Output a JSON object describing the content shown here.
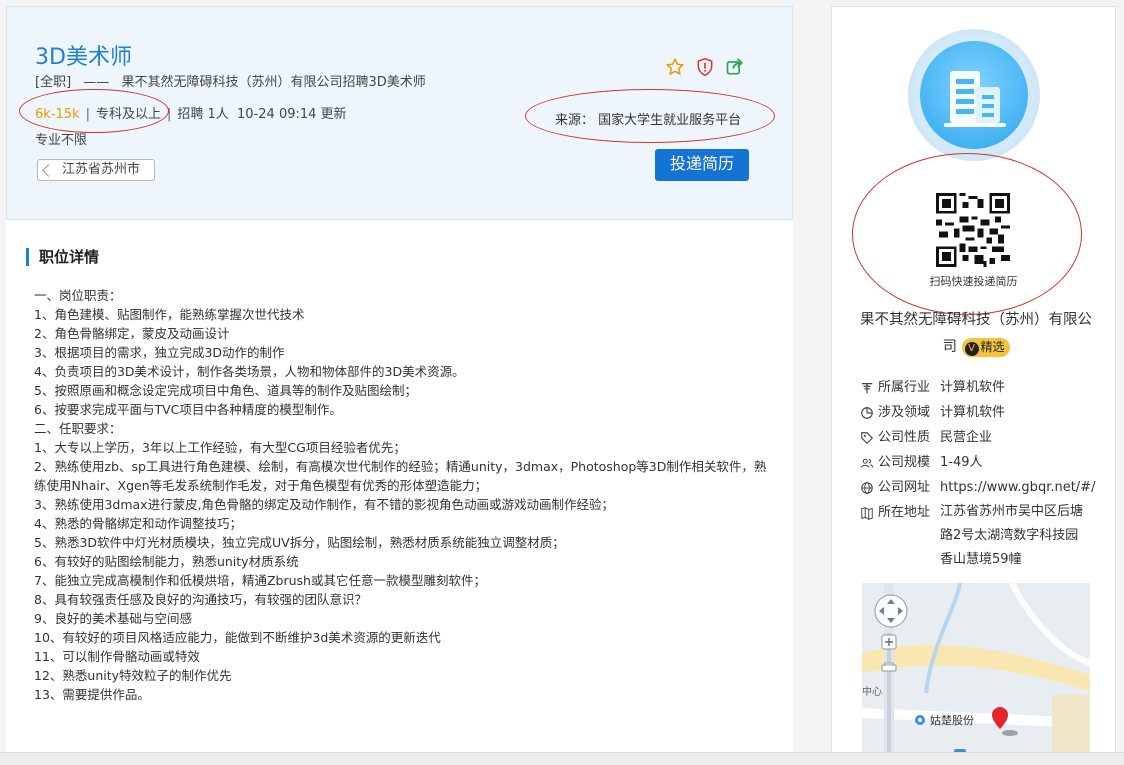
{
  "job": {
    "title": "3D美术师",
    "type": "[全职]",
    "dash": "——",
    "company_recruit": "果不其然无障碍科技（苏州）有限公司招聘3D美术师",
    "salary": "6k-15k",
    "education": "专科及以上",
    "headcount": "招聘 1人",
    "updated": "10-24 09:14 更新",
    "major": "专业不限",
    "location": "江苏省苏州市",
    "source": "来源： 国家大学生就业服务平台",
    "apply_label": "投递简历",
    "icons": [
      "star-icon",
      "shield-alert-icon",
      "share-icon"
    ]
  },
  "detail": {
    "section_title": "职位详情",
    "lines": [
      "一、岗位职责：",
      "1、角色建模、贴图制作，能熟练掌握次世代技术",
      "2、角色骨骼绑定，蒙皮及动画设计",
      "3、根据项目的需求，独立完成3D动作的制作",
      "4、负责项目的3D美术设计，制作各类场景，人物和物体部件的3D美术资源。",
      "5、按照原画和概念设定完成项目中角色、道具等的制作及贴图绘制；",
      "6、按要求完成平面与TVC项目中各种精度的模型制作。",
      "二、任职要求：",
      "1、大专以上学历，3年以上工作经验，有大型CG项目经验者优先；",
      "2、熟练使用zb、sp工具进行角色建模、绘制，有高模次世代制作的经验；精通unity，3dmax，Photoshop等3D制作相关软件，熟练使用Nhair、Xgen等毛发系统制作毛发，对于角色模型有优秀的形体塑造能力；",
      "3、熟练使用3dmax进行蒙皮,角色骨骼的绑定及动作制作，有不错的影视角色动画或游戏动画制作经验；",
      "4、熟悉的骨骼绑定和动作调整技巧；",
      "5、熟悉3D软件中灯光材质模块，独立完成UV拆分，贴图绘制，熟悉材质系统能独立调整材质；",
      "6、有较好的贴图绘制能力，熟悉unity材质系统",
      "7、能独立完成高模制作和低模烘培，精通Zbrush或其它任意一款模型雕刻软件；",
      "8、具有较强责任感及良好的沟通技巧，有较强的团队意识？",
      "9、良好的美术基础与空间感",
      "10、有较好的项目风格适应能力，能做到不断维护3d美术资源的更新迭代",
      "11、可以制作骨骼动画或特效",
      "12、熟悉unity特效粒子的制作优先",
      "13、需要提供作品。"
    ]
  },
  "side": {
    "qr_caption": "扫码快速投递简历",
    "company_name": "果不其然无障碍科技（苏州）有限公司",
    "badge_v": "V",
    "badge_label": "精选",
    "info": [
      {
        "icon": "industry-icon",
        "key": "所属行业",
        "value": "计算机软件"
      },
      {
        "icon": "domain-icon",
        "key": "涉及领域",
        "value": "计算机软件"
      },
      {
        "icon": "tag-icon",
        "key": "公司性质",
        "value": "民营企业"
      },
      {
        "icon": "people-icon",
        "key": "公司规模",
        "value": "1-49人"
      },
      {
        "icon": "globe-icon",
        "key": "公司网址",
        "value": "https://www.gbqr.net/#/"
      },
      {
        "icon": "map-icon",
        "key": "所在地址",
        "value": "江苏省苏州市吴中区后塘路2号太湖湾数字科技园香山慧境59幢"
      }
    ],
    "map": {
      "poi_label": "姑楚股份",
      "edge_label": "中心"
    }
  },
  "colors": {
    "accent": "#1f7fd6",
    "salary": "#f39800",
    "button": "#1573d6",
    "annotation": "#d0342c"
  }
}
